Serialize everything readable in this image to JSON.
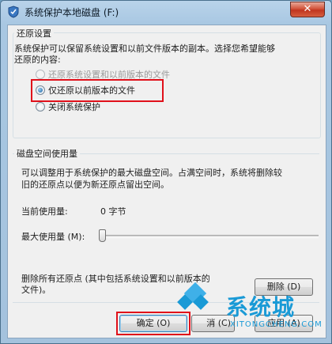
{
  "window": {
    "title": "系统保护本地磁盘 (F:)",
    "close_glyph": "✕"
  },
  "restore_settings": {
    "group_label": "还原设置",
    "description_line1": "系统保护可以保留系统设置和以前文件版本的副本。选择您希望能够",
    "description_line2": "还原的内容:",
    "options": [
      {
        "label": "还原系统设置和以前版本的文件",
        "selected": false,
        "enabled": false
      },
      {
        "label": "仅还原以前版本的文件",
        "selected": true,
        "enabled": true
      },
      {
        "label": "关闭系统保护",
        "selected": false,
        "enabled": true
      }
    ]
  },
  "disk_usage": {
    "group_label": "磁盘空间使用量",
    "description_line1": "可以调整用于系统保护的最大磁盘空间。占满空间时，系统将删除较",
    "description_line2": "旧的还原点以便为新还原点留出空间。",
    "current_label": "当前使用量:",
    "current_value": "0 字节",
    "max_label": "最大使用量 (M):",
    "max_slider_value": 0
  },
  "delete_section": {
    "description_line1": "删除所有还原点 (其中包括系统设置和以前版本的",
    "description_line2": "文件)。",
    "delete_button": "删除 (D)"
  },
  "buttons": {
    "ok": "确定 (O)",
    "cancel": "消 (C)",
    "apply": "应用 (A)"
  },
  "watermark": {
    "brand": "系统城",
    "url": "XITONGCHENG.COM"
  },
  "colors": {
    "highlight_red": "#e0101a",
    "watermark_blue": "#1a9ad6"
  }
}
